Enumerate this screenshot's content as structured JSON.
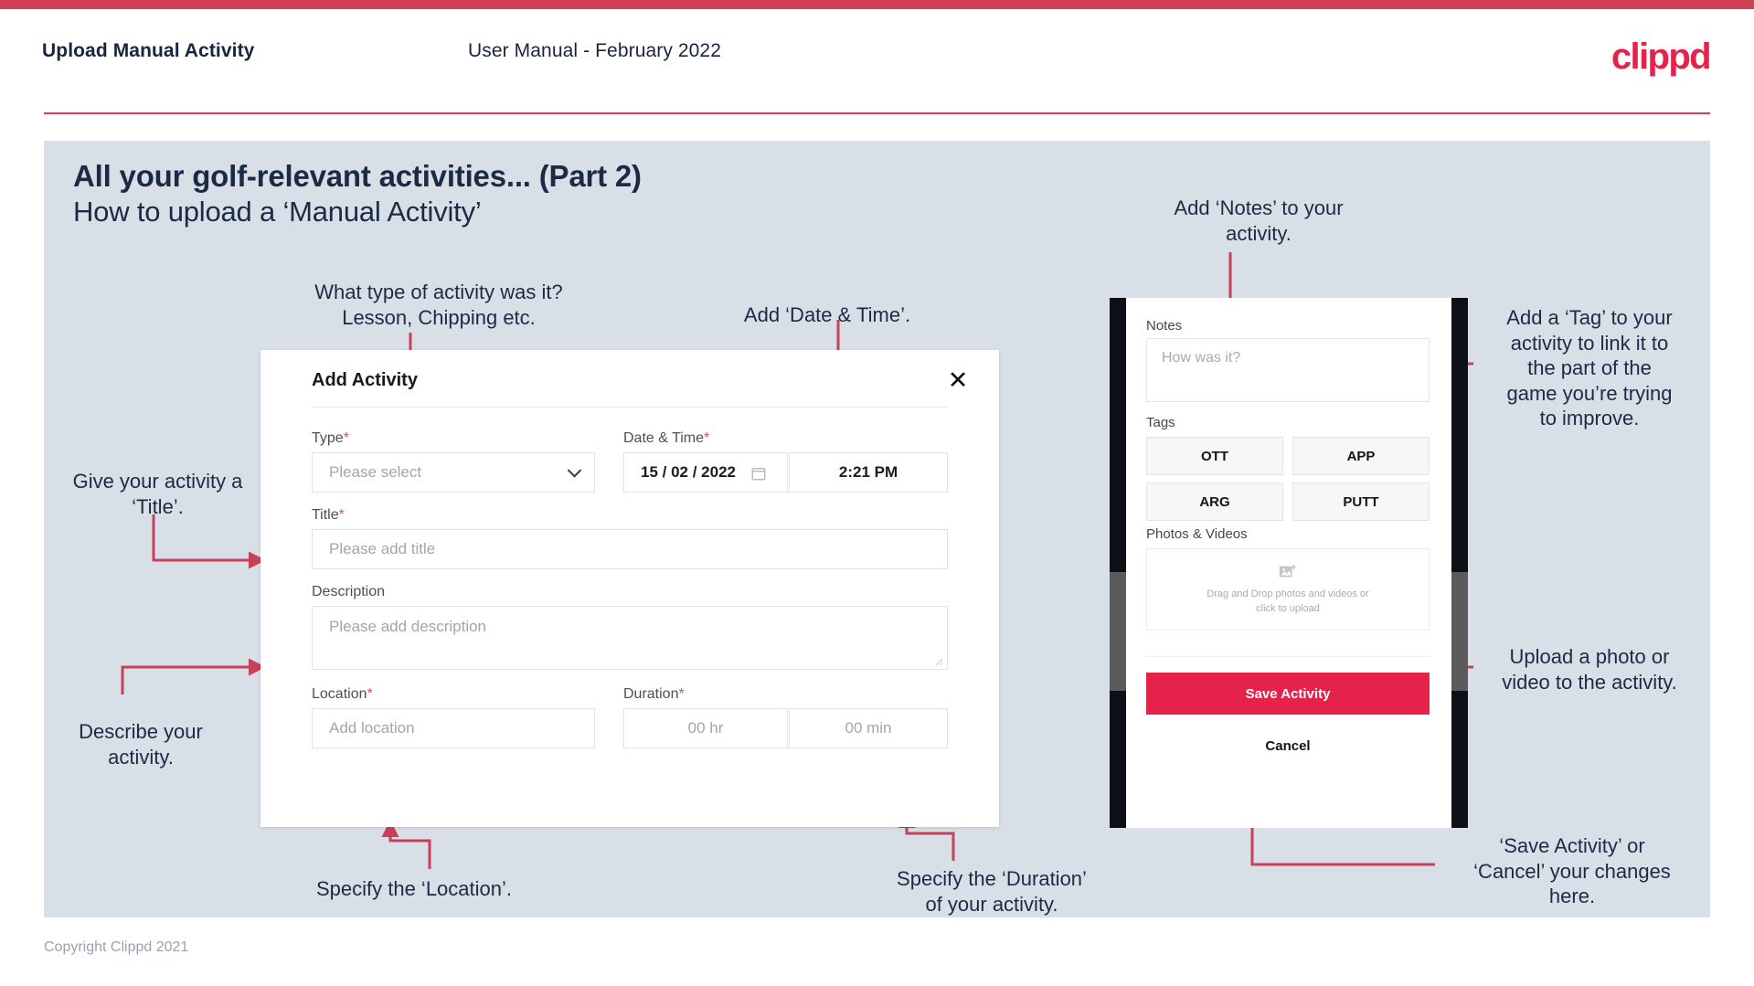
{
  "header": {
    "title": "Upload Manual Activity",
    "subtitle": "User Manual - February 2022",
    "logo": "clippd"
  },
  "slide": {
    "title": "All your golf-relevant activities... (Part 2)",
    "subtitle": "How to upload a ‘Manual Activity’"
  },
  "footer": {
    "copyright": "Copyright Clippd 2021"
  },
  "annotations": {
    "type": "What type of activity was it?\nLesson, Chipping etc.",
    "date_time": "Add ‘Date & Time’.",
    "title": "Give your activity a\n‘Title’.",
    "description": "Describe your\nactivity.",
    "location": "Specify the ‘Location’.",
    "duration": "Specify the ‘Duration’\nof your activity.",
    "notes": "Add ‘Notes’ to your\nactivity.",
    "tags": "Add a ‘Tag’ to your\nactivity to link it to\nthe part of the\ngame you’re trying\nto improve.",
    "photos": "Upload a photo or\nvideo to the activity.",
    "save_cancel": "‘Save Activity’ or\n‘Cancel’ your changes\nhere."
  },
  "dialog": {
    "title": "Add Activity",
    "close_icon": "close-icon",
    "fields": {
      "type": {
        "label": "Type",
        "required": "*",
        "placeholder": "Please select",
        "value": ""
      },
      "date_time": {
        "label": "Date & Time",
        "required": "*",
        "date_value": "15 /  02  / 2022",
        "calendar_icon": "calendar-icon",
        "time_value": "2:21 PM"
      },
      "title": {
        "label": "Title",
        "required": "*",
        "placeholder": "Please add title",
        "value": ""
      },
      "description": {
        "label": "Description",
        "required": "",
        "placeholder": "Please add description",
        "value": ""
      },
      "location": {
        "label": "Location",
        "required": "*",
        "placeholder": "Add location",
        "value": ""
      },
      "duration": {
        "label": "Duration",
        "required": "*",
        "hours_placeholder": "00 hr",
        "minutes_placeholder": "00 min"
      }
    }
  },
  "mobile": {
    "notes": {
      "label": "Notes",
      "placeholder": "How was it?"
    },
    "tags": {
      "label": "Tags",
      "items": [
        "OTT",
        "APP",
        "ARG",
        "PUTT"
      ]
    },
    "photos": {
      "label": "Photos & Videos",
      "icon": "add-image-icon",
      "dropzone_text": "Drag and Drop photos and videos or\nclick to upload"
    },
    "save_label": "Save Activity",
    "cancel_label": "Cancel"
  },
  "colors": {
    "brand_pink": "#e5224a",
    "accent_rule": "#cf4055",
    "slide_bg": "#d8dfe6",
    "text_dark": "#1c2b45",
    "arrow": "#c9405a"
  }
}
